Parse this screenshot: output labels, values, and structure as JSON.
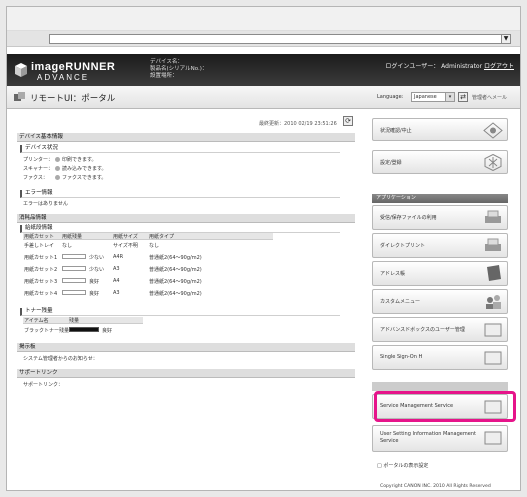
{
  "browser": {
    "address_button": "▼"
  },
  "header": {
    "logo_line1": "imageRUNNER",
    "logo_line2": "ADVANCE",
    "device_name_label": "デバイス名：",
    "product_label": "製品名(シリアルNo.)：",
    "location_label": "設置場所：",
    "login_user_label": "ログインユーザー：",
    "login_user_name": "Administrator",
    "logout_label": "ログアウト"
  },
  "titlebar": {
    "title": "リモートUI：ポータル",
    "language_label": "Language:",
    "language_value": "Japanese",
    "admin_mail": "管理者へメール"
  },
  "main": {
    "last_updated": "最終更新：2010 02/19 23:51:26",
    "device_info_title": "デバイス基本情報",
    "device_status_title": "デバイス状況",
    "status_rows": [
      {
        "label": "プリンター：",
        "value": "印刷できます。"
      },
      {
        "label": "スキャナー：",
        "value": "読み込みできます。"
      },
      {
        "label": "ファクス：",
        "value": "ファクスできます。"
      }
    ],
    "error_title": "エラー情報",
    "error_text": "エラーはありません",
    "consumables_title": "消耗品情報",
    "paper_title": "給紙段情報",
    "paper_headers": [
      "用紙カセット",
      "用紙残量",
      "用紙サイズ",
      "用紙タイプ"
    ],
    "paper_rows": [
      {
        "name": "手差しトレイ",
        "level": "なし",
        "size": "サイズ不明",
        "type": "なし",
        "bar": false
      },
      {
        "name": "用紙カセット1",
        "level": "少ない",
        "size": "A4R",
        "type": "普通紙2(64〜90g/m2)",
        "bar": true
      },
      {
        "name": "用紙カセット2",
        "level": "少ない",
        "size": "A3",
        "type": "普通紙2(64〜90g/m2)",
        "bar": true
      },
      {
        "name": "用紙カセット3",
        "level": "良好",
        "size": "A4",
        "type": "普通紙2(64〜90g/m2)",
        "bar": true
      },
      {
        "name": "用紙カセット4",
        "level": "良好",
        "size": "A3",
        "type": "普通紙2(64〜90g/m2)",
        "bar": true
      }
    ],
    "toner_title": "トナー残量",
    "toner_headers": [
      "アイテム名",
      "残量"
    ],
    "toner_name": "ブラックトナー残量",
    "toner_level": "良好",
    "bulletin_title": "掲示板",
    "bulletin_text": "システム管理者からのお知らせ：",
    "support_title": "サポートリンク",
    "support_text": "サポートリンク："
  },
  "right": {
    "status_cancel": "状況確認/中止",
    "settings": "設定/登録",
    "apps_header": "アプリケーション",
    "apps": [
      "受信/保存ファイルの利用",
      "ダイレクトプリント",
      "アドレス帳",
      "カスタムメニュー",
      "アドバンスドボックスのユーザー管理",
      "Single Sign-On H"
    ],
    "service_mgmt": "Service Management Service",
    "user_setting_line1": "User Setting Information Management",
    "user_setting_line2": "Service",
    "portal_settings": "ポータルの表示設定",
    "copyright": "Copyright CANON INC. 2010 All Rights Reserved"
  }
}
